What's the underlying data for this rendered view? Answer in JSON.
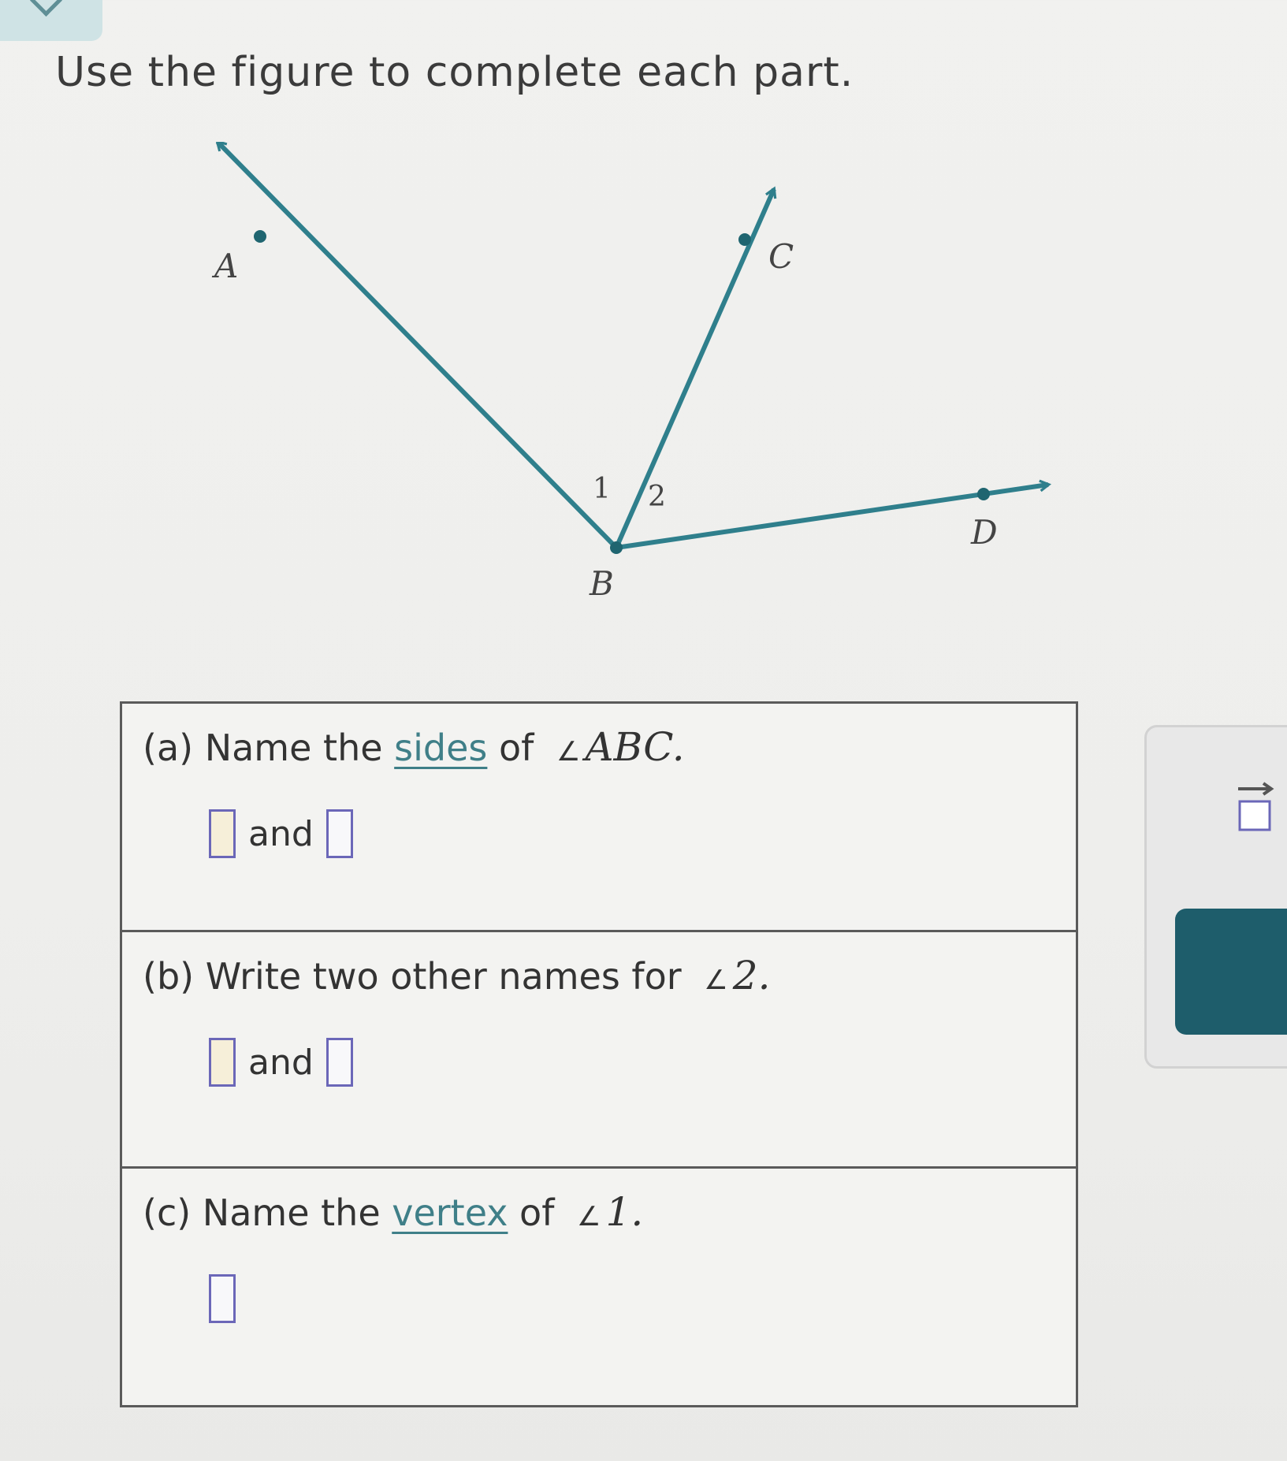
{
  "instructions": "Use the figure to complete each part.",
  "figure": {
    "point_labels": {
      "a": "A",
      "b": "B",
      "c": "C",
      "d": "D"
    },
    "angle_labels": {
      "one": "1",
      "two": "2"
    },
    "colors": {
      "ray": "#2f7f8c",
      "point": "#1f6570"
    }
  },
  "parts": {
    "a": {
      "label": "(a) Name the ",
      "term": "sides",
      "mid": " of ",
      "angle_symbol": "∠",
      "math": "ABC",
      "end": ".",
      "connector": "and"
    },
    "b": {
      "label": "(b) Write two other names for ",
      "angle_symbol": "∠",
      "math": "2",
      "end": ".",
      "connector": "and"
    },
    "c": {
      "label": "(c) Name the ",
      "term": "vertex",
      "mid": " of ",
      "angle_symbol": "∠",
      "math": "1",
      "end": "."
    }
  },
  "side_panel": {
    "ray_tool_icon": "ray-template-icon",
    "action_icon": "undo-icon",
    "colors": {
      "action_bg": "#1e5d6b"
    }
  }
}
